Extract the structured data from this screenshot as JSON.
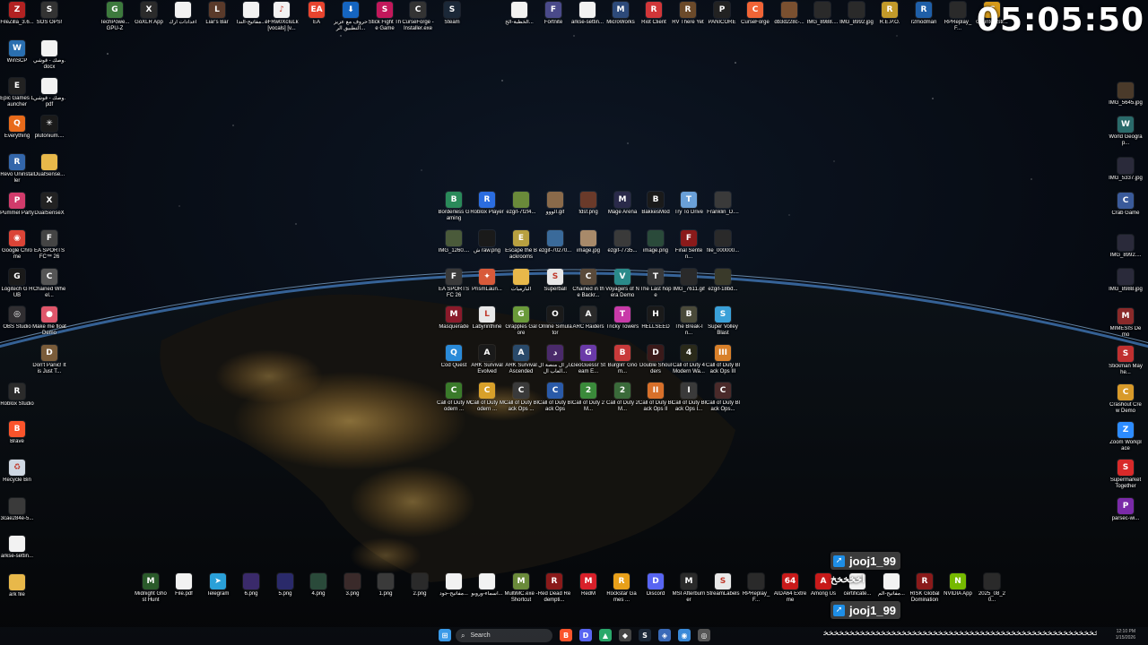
{
  "clock": "05:05:50",
  "colors": {
    "city_lights": "#f0b040",
    "horizon": "#5aa6ff",
    "taskbar": "#0c1018",
    "badge_arrow": "#1e8ee6"
  },
  "left_icons": [
    {
      "label": "FileZilla_3.6...",
      "icon": "filezilla-icon",
      "color": "#b22222",
      "glyph": "Z"
    },
    {
      "label": "SOS OPS!",
      "icon": "sos-ops-icon",
      "color": "#333333",
      "glyph": "S"
    },
    {
      "label": "WinSCP",
      "icon": "winscp-icon",
      "color": "#2a6fb0",
      "glyph": "W"
    },
    {
      "label": "وصك - قوشي.docx",
      "icon": "document-icon",
      "color": "#f2f2f2",
      "glyph": ""
    },
    {
      "label": "Epic Games Launcher",
      "icon": "epic-games-icon",
      "color": "#222222",
      "glyph": "E"
    },
    {
      "label": "وصك - قوشي.pdf",
      "icon": "pdf-icon",
      "color": "#f2f2f2",
      "glyph": ""
    },
    {
      "label": "Everything",
      "icon": "everything-icon",
      "color": "#e86a1a",
      "glyph": "Q"
    },
    {
      "label": "plutonium....",
      "icon": "plutonium-icon",
      "color": "#1a1a1a",
      "glyph": "✳"
    },
    {
      "label": "Revo Uninstaller",
      "icon": "revo-uninstaller-icon",
      "color": "#3366aa",
      "glyph": "R"
    },
    {
      "label": "DualSense...",
      "icon": "folder-icon",
      "color": "#e8b84a",
      "glyph": ""
    },
    {
      "label": "Pummel Party",
      "icon": "pummel-party-icon",
      "color": "#d13b6b",
      "glyph": "P"
    },
    {
      "label": "DualSenseX",
      "icon": "dualsensex-icon",
      "color": "#222222",
      "glyph": "X"
    },
    {
      "label": "Google Chrome",
      "icon": "chrome-icon",
      "color": "#db4437",
      "glyph": "◉"
    },
    {
      "label": "EA SPORTS FC™ 26",
      "icon": "ea-fc-icon",
      "color": "#444444",
      "glyph": "F"
    },
    {
      "label": "Logitech G HUB",
      "icon": "logitech-icon",
      "color": "#1a1a1a",
      "glyph": "G"
    },
    {
      "label": "Chained Wheel...",
      "icon": "chained-wheel-icon",
      "color": "#555555",
      "glyph": "C"
    },
    {
      "label": "OBS Studio",
      "icon": "obs-icon",
      "color": "#302e31",
      "glyph": "◎"
    },
    {
      "label": "Make me float Demo",
      "icon": "make-me-float-icon",
      "color": "#e0566b",
      "glyph": "●"
    },
    {
      "label": "Don't Panic! It is Just T...",
      "icon": "dont-panic-icon",
      "color": "#7a5c3a",
      "glyph": "D"
    },
    {
      "label": "Roblox Studio",
      "icon": "roblox-studio-icon",
      "color": "#2b2b2b",
      "glyph": "R"
    },
    {
      "label": "Brave",
      "icon": "brave-icon",
      "color": "#fb542b",
      "glyph": "B"
    },
    {
      "label": "Recycle Bin",
      "icon": "recycle-bin-icon",
      "color": "#cfd8e3",
      "glyph": "♻"
    },
    {
      "label": "3cae284e-5...",
      "icon": "image-file-icon",
      "color": "#3a3a3a",
      "glyph": ""
    },
    {
      "label": "arkse-settin...",
      "icon": "document-icon",
      "color": "#f2f2f2",
      "glyph": ""
    },
    {
      "label": "ark file",
      "icon": "folder-icon",
      "color": "#e8b84a",
      "glyph": ""
    }
  ],
  "top_icons": [
    {
      "label": "TechPowe... GPU-Z",
      "icon": "gpuz-icon",
      "color": "#3d7a3d",
      "glyph": "G"
    },
    {
      "label": "GoXLR App",
      "icon": "goxlr-icon",
      "color": "#2b2b2b",
      "glyph": "X"
    },
    {
      "label": "اعدادات ارك",
      "icon": "document-icon",
      "color": "#f2f2f2",
      "glyph": ""
    },
    {
      "label": "Liar's Bar",
      "icon": "liars-bar-icon",
      "color": "#5a3a2a",
      "glyph": "L"
    },
    {
      "label": "مفاتيح-الندا...",
      "icon": "pdf-icon",
      "color": "#f2f2f2",
      "glyph": ""
    },
    {
      "label": "eFRw0XcIuLk [vocals] [v...",
      "icon": "audio-file-icon",
      "color": "#f2f2f2",
      "glyph": "♪"
    },
    {
      "label": "EA",
      "icon": "ea-icon",
      "color": "#e8442e",
      "glyph": "EA"
    },
    {
      "label": "حروف مع عزيز التطبيق الر...",
      "icon": "arabic-app-icon",
      "color": "#1565c0",
      "glyph": "⬇"
    },
    {
      "label": "Stick Fight The Game",
      "icon": "stick-fight-icon",
      "color": "#c2185b",
      "glyph": "S"
    },
    {
      "label": "CurseForge - Installer.exe",
      "icon": "curseforge-installer-icon",
      "color": "#333333",
      "glyph": "C"
    },
    {
      "label": "Steam",
      "icon": "steam-icon",
      "color": "#1b2838",
      "glyph": "S"
    },
    {
      "label": "الخطبة-الخ...",
      "icon": "pdf-icon",
      "color": "#f2f2f2",
      "glyph": ""
    },
    {
      "label": "Fortnite",
      "icon": "fortnite-icon",
      "color": "#4a4a8a",
      "glyph": "F"
    },
    {
      "label": "arkse-settin...",
      "icon": "document-icon",
      "color": "#f2f2f2",
      "glyph": ""
    },
    {
      "label": "MicroWorks",
      "icon": "microworks-icon",
      "color": "#2d4a7a",
      "glyph": "M"
    },
    {
      "label": "Riot Client",
      "icon": "riot-client-icon",
      "color": "#d13639",
      "glyph": "R"
    },
    {
      "label": "RV There Yet",
      "icon": "rv-there-yet-icon",
      "color": "#6b4a2a",
      "glyph": "R"
    },
    {
      "label": "PANICORE",
      "icon": "panicore-icon",
      "color": "#222222",
      "glyph": "P"
    },
    {
      "label": "CurseForge",
      "icon": "curseforge-icon",
      "color": "#f16436",
      "glyph": "C"
    },
    {
      "label": "db3d228c-...",
      "icon": "image-file-icon",
      "color": "#7a5030",
      "glyph": ""
    },
    {
      "label": "IMG_8988....",
      "icon": "image-file-icon",
      "color": "#2a2a2a",
      "glyph": ""
    },
    {
      "label": "IMG_8992.jpg",
      "icon": "image-file-icon",
      "color": "#2a2a2a",
      "glyph": ""
    },
    {
      "label": "R.E.P.O.",
      "icon": "repo-icon",
      "color": "#c29a2a",
      "glyph": "R"
    },
    {
      "label": "r2modman",
      "icon": "r2modman-icon",
      "color": "#1f5fa8",
      "glyph": "R"
    },
    {
      "label": "RPReplay_F...",
      "icon": "video-file-icon",
      "color": "#2a2a2a",
      "glyph": ""
    },
    {
      "label": "Counter-Str... 2",
      "icon": "cs2-icon",
      "color": "#d69a1a",
      "glyph": "C"
    }
  ],
  "right_icons": [
    {
      "label": "IMG_5645.jpg",
      "icon": "image-file-icon",
      "color": "#4a3a2a",
      "glyph": ""
    },
    {
      "label": "World Geograp...",
      "icon": "world-geography-icon",
      "color": "#2a6a6a",
      "glyph": "W"
    },
    {
      "label": "IMG_5337.jpg",
      "icon": "image-file-icon",
      "color": "#2a2a3a",
      "glyph": ""
    },
    {
      "label": "Crab Game",
      "icon": "crab-game-icon",
      "color": "#3a5a9a",
      "glyph": "C"
    },
    {
      "label": "IMG_8992....",
      "icon": "image-file-icon",
      "color": "#2a2a3a",
      "glyph": ""
    },
    {
      "label": "IMG_8988.jpg",
      "icon": "image-file-icon",
      "color": "#2a2a3a",
      "glyph": ""
    },
    {
      "label": "MIMESIS Demo",
      "icon": "mimesis-icon",
      "color": "#8a2a2a",
      "glyph": "M"
    },
    {
      "label": "Stickman Mayhe...",
      "icon": "stickman-mayhem-icon",
      "color": "#c03030",
      "glyph": "S"
    },
    {
      "label": "Crashout Crew Demo",
      "icon": "crashout-crew-icon",
      "color": "#d89a2a",
      "glyph": "C"
    },
    {
      "label": "Zoom Workplace",
      "icon": "zoom-icon",
      "color": "#2d8cff",
      "glyph": "Z"
    },
    {
      "label": "Supermarket Together",
      "icon": "supermarket-together-icon",
      "color": "#d82a2a",
      "glyph": "S"
    },
    {
      "label": "parsec-wi...",
      "icon": "parsec-icon",
      "color": "#7a2aa8",
      "glyph": "P"
    }
  ],
  "grid_icons": [
    {
      "label": "Borderless Gaming",
      "icon": "borderless-gaming-icon",
      "color": "#2a8a5a",
      "glyph": "B"
    },
    {
      "label": "Roblox Player",
      "icon": "roblox-icon",
      "color": "#2b6de0",
      "glyph": "R"
    },
    {
      "label": "ezgif-7f2f4...",
      "icon": "image-file-icon",
      "color": "#6a8a3a",
      "glyph": ""
    },
    {
      "label": "الووو.gif",
      "icon": "image-file-icon",
      "color": "#8a6a4a",
      "glyph": ""
    },
    {
      "label": "fdsf.png",
      "icon": "image-file-icon",
      "color": "#6a3a2a",
      "glyph": ""
    },
    {
      "label": "Mage Arena",
      "icon": "mage-arena-icon",
      "color": "#2a2a4a",
      "glyph": "M"
    },
    {
      "label": "BakkesMod",
      "icon": "bakkesmod-icon",
      "color": "#1a1a1a",
      "glyph": "B"
    },
    {
      "label": "Try To Drive",
      "icon": "try-to-drive-icon",
      "color": "#6aa0d8",
      "glyph": "T"
    },
    {
      "label": "Franklin_D....",
      "icon": "image-file-icon",
      "color": "#3a3a3a",
      "glyph": ""
    },
    {
      "label": "IMG_1260....",
      "icon": "image-file-icon",
      "color": "#4a5a3a",
      "glyph": ""
    },
    {
      "label": "ش raw.png",
      "icon": "image-file-icon",
      "color": "#1a1a1a",
      "glyph": ""
    },
    {
      "label": "Escape the Backrooms",
      "icon": "escape-backrooms-icon",
      "color": "#b8a040",
      "glyph": "E"
    },
    {
      "label": "ezgif-70270...",
      "icon": "image-file-icon",
      "color": "#3a6a9a",
      "glyph": ""
    },
    {
      "label": "image.jpg",
      "icon": "image-file-icon",
      "color": "#a88a6a",
      "glyph": ""
    },
    {
      "label": "ezgif-7735...",
      "icon": "image-file-icon",
      "color": "#3a3a3a",
      "glyph": ""
    },
    {
      "label": "image.png",
      "icon": "image-file-icon",
      "color": "#2a4a3a",
      "glyph": ""
    },
    {
      "label": "Final Senten...",
      "icon": "final-sentence-icon",
      "color": "#8a1a1a",
      "glyph": "F"
    },
    {
      "label": "file_000000...",
      "icon": "image-file-icon",
      "color": "#2a2a2a",
      "glyph": ""
    },
    {
      "label": "EA SPORTS FC 26",
      "icon": "ea-fc-icon",
      "color": "#3a3a3a",
      "glyph": "F"
    },
    {
      "label": "PrismLaun...",
      "icon": "prism-launcher-icon",
      "color": "#d85a3a",
      "glyph": "✦"
    },
    {
      "label": "البارميات",
      "icon": "folder-icon",
      "color": "#e8b84a",
      "glyph": ""
    },
    {
      "label": "Superball",
      "icon": "superball-icon",
      "color": "#e8e8e8",
      "glyph": "S"
    },
    {
      "label": "Chained in the Backr...",
      "icon": "chained-backrooms-icon",
      "color": "#5a4a3a",
      "glyph": "C"
    },
    {
      "label": "Voyagers of Nera Demo",
      "icon": "voyagers-of-nera-icon",
      "color": "#2a8a8a",
      "glyph": "V"
    },
    {
      "label": "The Last hope",
      "icon": "the-last-hope-icon",
      "color": "#3a3a3a",
      "glyph": "T"
    },
    {
      "label": "IMG_7611.gif",
      "icon": "image-file-icon",
      "color": "#2a2a2a",
      "glyph": ""
    },
    {
      "label": "ezgif-18bd...",
      "icon": "image-file-icon",
      "color": "#3a3a2a",
      "glyph": ""
    },
    {
      "label": "Masquerade",
      "icon": "masquerade-icon",
      "color": "#8a1a2a",
      "glyph": "M"
    },
    {
      "label": "Labyrinthine",
      "icon": "labyrinthine-icon",
      "color": "#e8e8e8",
      "glyph": "L"
    },
    {
      "label": "Grapples Galore",
      "icon": "grapples-galore-icon",
      "color": "#6a9a3a",
      "glyph": "G"
    },
    {
      "label": "Online Simulator",
      "icon": "online-simulator-icon",
      "color": "#1a1a1a",
      "glyph": "O"
    },
    {
      "label": "ARC Raiders",
      "icon": "arc-raiders-icon",
      "color": "#2a2a2a",
      "glyph": "A"
    },
    {
      "label": "Tricky Towers",
      "icon": "tricky-towers-icon",
      "color": "#c83aa8",
      "glyph": "T"
    },
    {
      "label": "HELLSEED",
      "icon": "hellseed-icon",
      "color": "#1a1a1a",
      "glyph": "H"
    },
    {
      "label": "The Break-In...",
      "icon": "the-break-in-icon",
      "color": "#4a4a3a",
      "glyph": "B"
    },
    {
      "label": "Super Volley Blast",
      "icon": "super-volley-blast-icon",
      "color": "#3aa0d8",
      "glyph": "S"
    },
    {
      "label": "Cod Quest",
      "icon": "cod-quest-icon",
      "color": "#2a8ad8",
      "glyph": "Q"
    },
    {
      "label": "ARK Survival Evolved",
      "icon": "ark-evolved-icon",
      "color": "#1a1a1a",
      "glyph": "A"
    },
    {
      "label": "ARK Survival Ascended",
      "icon": "ark-ascended-icon",
      "color": "#2a4a6a",
      "glyph": "A"
    },
    {
      "label": "دار ال منصة ال العاب ال...",
      "icon": "arabic-games-icon",
      "color": "#4a2a6a",
      "glyph": "د"
    },
    {
      "label": "GeoGuessr Steam E...",
      "icon": "geoguessr-icon",
      "color": "#6a3aa8",
      "glyph": "G"
    },
    {
      "label": "Burglin' Gnom...",
      "icon": "burglin-gnomes-icon",
      "color": "#c83a3a",
      "glyph": "B"
    },
    {
      "label": "Double Shoulders",
      "icon": "double-shoulders-icon",
      "color": "#3a1a1a",
      "glyph": "D"
    },
    {
      "label": "Call of Duty 4 Modern Wa...",
      "icon": "cod4-icon",
      "color": "#2a2a1a",
      "glyph": "4"
    },
    {
      "label": "Call of Duty Black Ops III",
      "icon": "cod-bo3-icon",
      "color": "#d8802a",
      "glyph": "III"
    },
    {
      "label": "Call of Duty Modern ...",
      "icon": "cod-mw-icon",
      "color": "#3a7a2a",
      "glyph": "C"
    },
    {
      "label": "Call of Duty Modern ...",
      "icon": "cod-mw-icon",
      "color": "#d8a02a",
      "glyph": "C"
    },
    {
      "label": "Call of Duty Black Ops ...",
      "icon": "cod-bo-icon",
      "color": "#3a3a3a",
      "glyph": "C"
    },
    {
      "label": "Call of Duty Black Ops",
      "icon": "cod-bo-icon",
      "color": "#2a5aa8",
      "glyph": "C"
    },
    {
      "label": "Call of Duty 2 M...",
      "icon": "cod2-icon",
      "color": "#3a8a3a",
      "glyph": "2"
    },
    {
      "label": "Call of Duty 2 M...",
      "icon": "cod2-icon",
      "color": "#3a6a3a",
      "glyph": "2"
    },
    {
      "label": "Call of Duty Black Ops II",
      "icon": "cod-bo2-icon",
      "color": "#d8702a",
      "glyph": "II"
    },
    {
      "label": "Call of Duty Black Ops I...",
      "icon": "cod-bo-icon",
      "color": "#3a3a3a",
      "glyph": "I"
    },
    {
      "label": "Call of Duty Black Ops...",
      "icon": "cod-bo-icon",
      "color": "#4a2a2a",
      "glyph": "C"
    }
  ],
  "bottom_icons": [
    {
      "label": "Midnight Ghost Hunt",
      "icon": "midnight-ghost-hunt-icon",
      "color": "#2a5a2a",
      "glyph": "M"
    },
    {
      "label": "File.pdf",
      "icon": "pdf-icon",
      "color": "#f2f2f2",
      "glyph": ""
    },
    {
      "label": "Telegram",
      "icon": "telegram-icon",
      "color": "#2aa0d8",
      "glyph": "➤"
    },
    {
      "label": "6.png",
      "icon": "image-file-icon",
      "color": "#3a2a6a",
      "glyph": ""
    },
    {
      "label": "5.png",
      "icon": "image-file-icon",
      "color": "#2a2a6a",
      "glyph": ""
    },
    {
      "label": "4.png",
      "icon": "image-file-icon",
      "color": "#2a4a3a",
      "glyph": ""
    },
    {
      "label": "3.png",
      "icon": "image-file-icon",
      "color": "#3a2a2a",
      "glyph": ""
    },
    {
      "label": "1.png",
      "icon": "image-file-icon",
      "color": "#3a3a3a",
      "glyph": ""
    },
    {
      "label": "2.png",
      "icon": "image-file-icon",
      "color": "#2a2a2a",
      "glyph": ""
    },
    {
      "label": "مفاتيح-جود...",
      "icon": "pdf-icon",
      "color": "#f2f2f2",
      "glyph": ""
    },
    {
      "label": "اسماء-وروبو...",
      "icon": "pdf-icon",
      "color": "#f2f2f2",
      "glyph": ""
    },
    {
      "label": "MultiMC.exe - Shortcut",
      "icon": "multimc-icon",
      "color": "#6a8a3a",
      "glyph": "M"
    },
    {
      "label": "Red Dead Redempti...",
      "icon": "red-dead-icon",
      "color": "#8a1a1a",
      "glyph": "R"
    },
    {
      "label": "RedM",
      "icon": "redm-icon",
      "color": "#d8202a",
      "glyph": "M"
    },
    {
      "label": "Rockstar Games ...",
      "icon": "rockstar-icon",
      "color": "#e8a01a",
      "glyph": "R"
    },
    {
      "label": "Discord",
      "icon": "discord-icon",
      "color": "#5865f2",
      "glyph": "D"
    },
    {
      "label": "MSI Afterburner",
      "icon": "msi-afterburner-icon",
      "color": "#2a2a2a",
      "glyph": "M"
    },
    {
      "label": "StreamLabels",
      "icon": "streamlabels-icon",
      "color": "#e8e8e8",
      "glyph": "S"
    },
    {
      "label": "RPReplay_F...",
      "icon": "video-file-icon",
      "color": "#2a2a2a",
      "glyph": ""
    },
    {
      "label": "AIDA64 Extreme",
      "icon": "aida64-icon",
      "color": "#c81a1a",
      "glyph": "64"
    },
    {
      "label": "Among Us",
      "icon": "among-us-icon",
      "color": "#c81a1a",
      "glyph": "A"
    },
    {
      "label": "certificate...",
      "icon": "document-icon",
      "color": "#f2f2f2",
      "glyph": ""
    },
    {
      "label": "مفاتيح-الم...",
      "icon": "pdf-icon",
      "color": "#f2f2f2",
      "glyph": ""
    },
    {
      "label": "RISK Global Domination",
      "icon": "risk-icon",
      "color": "#8a1a1a",
      "glyph": "R"
    },
    {
      "label": "NVIDIA App",
      "icon": "nvidia-icon",
      "color": "#76b900",
      "glyph": "N"
    },
    {
      "label": "2025_08_20...",
      "icon": "image-file-icon",
      "color": "#2a2a2a",
      "glyph": ""
    }
  ],
  "taskbar": {
    "search_placeholder": "Search",
    "tray_time": "12:10 PM",
    "tray_date": "1/15/2026",
    "apps": [
      {
        "icon": "windows-start-icon",
        "color": "#3a9ae8",
        "glyph": "⊞"
      },
      {
        "icon": "brave-icon",
        "color": "#fb542b",
        "glyph": "B"
      },
      {
        "icon": "discord-icon",
        "color": "#5865f2",
        "glyph": "D"
      },
      {
        "icon": "app-icon",
        "color": "#2aa86a",
        "glyph": "▲"
      },
      {
        "icon": "app-icon",
        "color": "#444444",
        "glyph": "◆"
      },
      {
        "icon": "steam-icon",
        "color": "#1b2838",
        "glyph": "S"
      },
      {
        "icon": "app-icon",
        "color": "#3a6ab8",
        "glyph": "◈"
      },
      {
        "icon": "app-icon",
        "color": "#3a8ad8",
        "glyph": "◉"
      },
      {
        "icon": "app-icon",
        "color": "#555555",
        "glyph": "◎"
      }
    ]
  },
  "chat": {
    "username_1": "jooj1_99",
    "message": "اخخخخخ",
    "username_2": "jooj1_99",
    "spam": "ﺨﺨﺨﺨﺨﺨﺨﺨﺨﺨﺨﺨﺨﺨﺨﺨﺨﺨﺨﺨﺨﺨﺨﺨﺨﺨﺨﺨﺨﺨﺨﺨﺨﺨﺨﺨﺨﺨﺨﺨﺨﺨﺨﺨﺨﺨﺨﺨﺨﺨﺨﺨﺨﺨﺨﺨﺨﺨﺨﺨﺨﺨﺨﺨﺨﺨﺨﺨﺨﺨﺨﺨﺨﺨ"
  }
}
